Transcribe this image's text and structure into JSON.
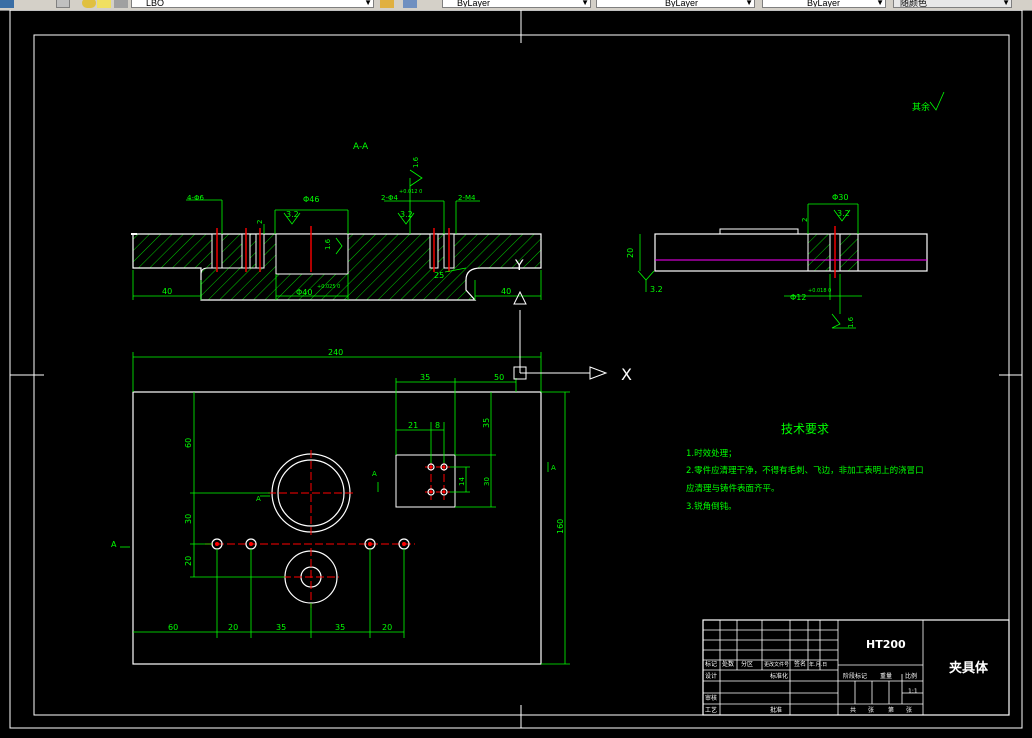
{
  "toolbar": {
    "layer_value": "LBO",
    "color_value": "ByLayer",
    "linetype_value": "ByLayer",
    "lineweight_value": "ByLayer",
    "plotstyle_value": "随颜色"
  },
  "drawing": {
    "section_label": "A-A",
    "other_roughness": "其余",
    "ucs_x_label": "X",
    "ucs_y_label": "Y",
    "colors": {
      "background": "#000000",
      "outline": "#ffffff",
      "dimension": "#00ff00",
      "centerline": "#ff0000",
      "hidden_edge": "#ff00ff"
    },
    "section_view": {
      "holes_4": "4-Φ6",
      "dia_46": "Φ46",
      "holes_2_small": "2-Φ4",
      "tol_small": "+0.012 0",
      "threads_2": "2-M4",
      "rough_a": "3.2",
      "rough_b": "3.2",
      "rough_top": "1.6",
      "rough_left": "1.6",
      "dim_2": "2",
      "dim_40_left": "40",
      "dim_40_right": "40",
      "bore": "Φ40",
      "bore_tol": "+0.025 0",
      "radius": "25"
    },
    "side_view": {
      "dia_30": "Φ30",
      "rough": "3.2",
      "rough_bottom": "3.2",
      "rough_low": "1.6",
      "dim_2": "2",
      "height": "20",
      "dia_12": "Φ12",
      "tol": "+0.018 0"
    },
    "plan_view": {
      "width_240": "240",
      "dim_35_top": "35",
      "dim_50": "50",
      "dim_21": "21",
      "dim_8": "8",
      "dim_35_right": "35",
      "dim_60_v": "60",
      "dim_14": "14",
      "dim_30_v": "30",
      "dim_30_left": "30",
      "dim_20_v": "20",
      "height_160": "160",
      "dim_60_h": "60",
      "dim_20_h1": "20",
      "dim_35_h1": "35",
      "dim_35_h2": "35",
      "dim_20_h2": "20",
      "cut_a_left": "A",
      "cut_a_mid": "A",
      "cut_a_right": "A",
      "cut_a_small": "A"
    },
    "tech_req": {
      "title": "技术要求",
      "items": [
        "1.时效处理；",
        "2.零件应清理干净，不得有毛刺、飞边，非加工表明上的浇冒口",
        "应清理与铸件表面齐平。",
        "3.锐角倒钝。"
      ]
    },
    "title_block": {
      "material": "HT200",
      "part_name": "夹具体",
      "scale": "1:1",
      "row_1": [
        "标记",
        "处数",
        "分区",
        "更改文件号",
        "签名",
        "年.月.日"
      ],
      "designer": "设计",
      "standardize": "标准化",
      "review": "审核",
      "process": "工艺",
      "approve": "批准",
      "stage_header": [
        "阶段标记",
        "重量",
        "比例"
      ],
      "sheet_footer": [
        "共",
        "张",
        "第",
        "张"
      ]
    }
  }
}
